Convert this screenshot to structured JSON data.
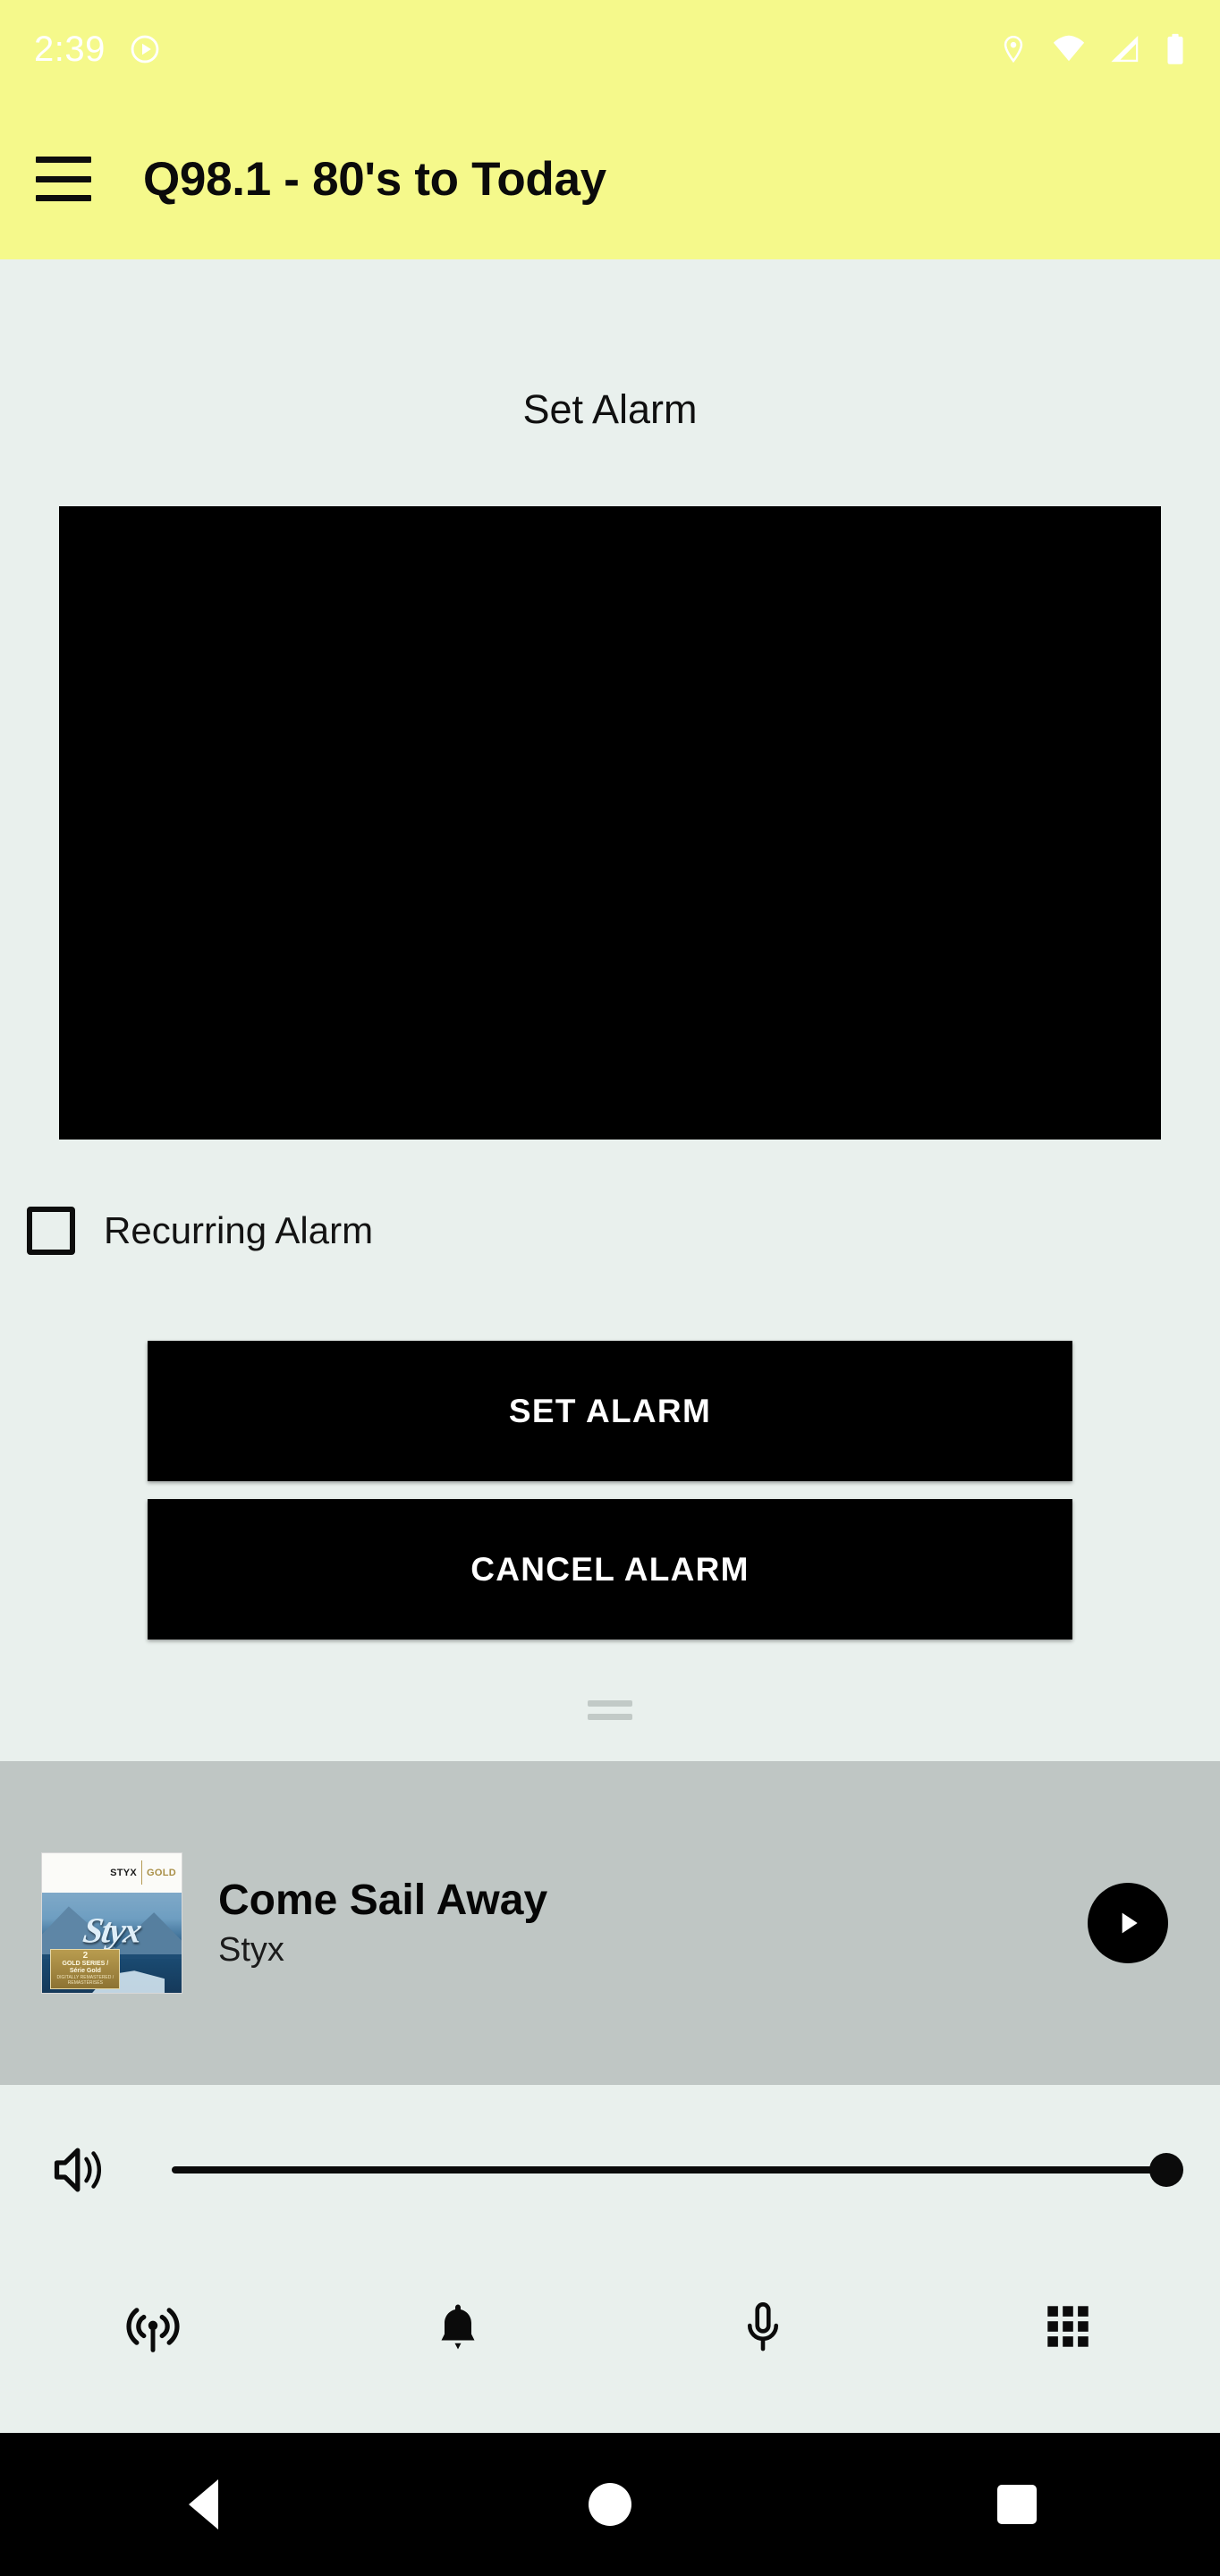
{
  "status_bar": {
    "clock": "2:39",
    "left_icons": [
      {
        "name": "play-circle-status-icon",
        "glyph": "play-circle"
      }
    ],
    "right_icons": [
      {
        "name": "location-pin-icon",
        "glyph": "location"
      },
      {
        "name": "wifi-icon",
        "glyph": "wifi"
      },
      {
        "name": "cellular-signal-icon",
        "glyph": "signal"
      },
      {
        "name": "battery-icon",
        "glyph": "battery"
      }
    ],
    "background_color": "#f5f98b",
    "foreground_color": "#ffffff"
  },
  "app_bar": {
    "menu_icon": "hamburger-menu-icon",
    "title": "Q98.1 - 80's to Today",
    "background_color": "#f5f98b",
    "title_color": "#0b0b0b"
  },
  "main": {
    "section_title": "Set Alarm",
    "time_picker": {
      "name": "time-picker",
      "background_color": "#000000"
    },
    "recurring": {
      "label": "Recurring Alarm",
      "checked": false
    },
    "buttons": {
      "set_alarm": "SET ALARM",
      "cancel_alarm": "CANCEL ALARM",
      "background_color": "#000000",
      "text_color": "#ffffff"
    },
    "drag_handle": "drag-handle",
    "background_color": "#e9f0ed"
  },
  "now_playing": {
    "title": "Come Sail Away",
    "artist": "Styx",
    "play_button_state": "play",
    "background_color": "#bfc6c4",
    "album_art": {
      "name": "album-art-styx-gold",
      "band": "STYX",
      "series": "GOLD",
      "badge_number": "2",
      "badge_line1": "GOLD SERIES /",
      "badge_line2": "Série Gold",
      "badge_line3": "DIGITALLY REMASTERED /",
      "badge_line4": "REMASTÉRISÉS",
      "logo_text": "Styx"
    }
  },
  "volume": {
    "icon": "volume-up-icon",
    "value": 100,
    "min": 0,
    "max": 100,
    "track_color": "#0b0b0b"
  },
  "tab_bar": {
    "items": [
      {
        "name": "tab-broadcast",
        "icon": "broadcast-tower-icon",
        "selected": false
      },
      {
        "name": "tab-alarm",
        "icon": "bell-icon",
        "selected": true
      },
      {
        "name": "tab-microphone",
        "icon": "microphone-icon",
        "selected": false
      },
      {
        "name": "tab-apps",
        "icon": "grid-apps-icon",
        "selected": false
      }
    ],
    "background_color": "#e9f0ed"
  },
  "system_nav": {
    "back": "back-triangle-icon",
    "home": "home-circle-icon",
    "recents": "recents-square-icon",
    "background_color": "#000000"
  }
}
